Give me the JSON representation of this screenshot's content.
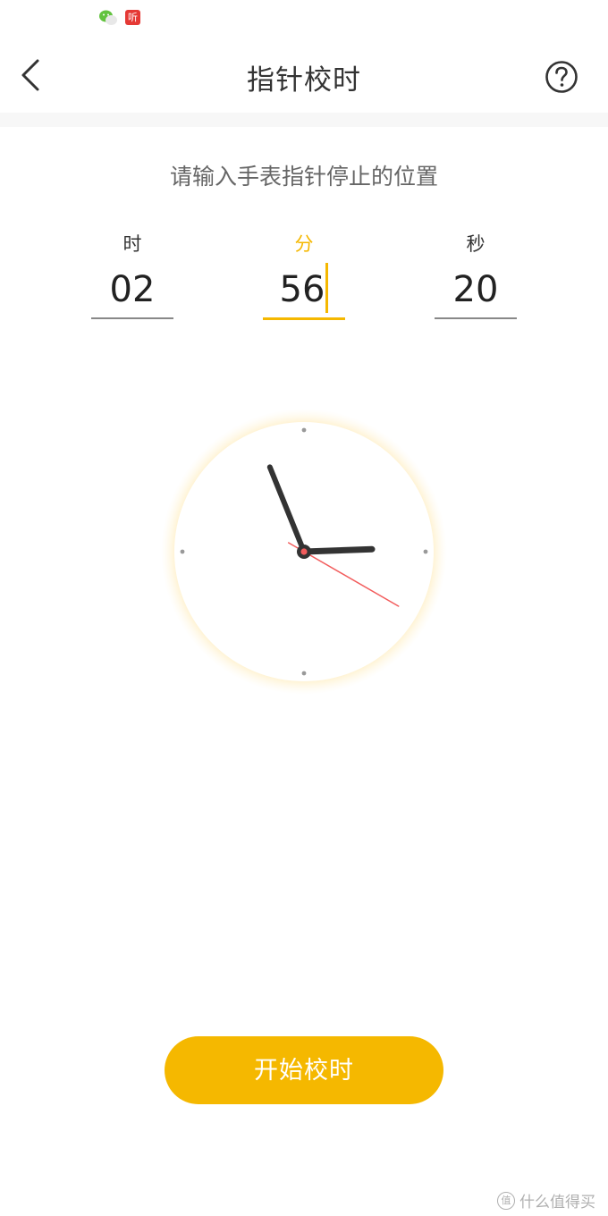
{
  "status_bar": {
    "icons": [
      "wechat-icon",
      "ting-app-icon"
    ],
    "ting_label": "听"
  },
  "header": {
    "title": "指针校时",
    "back_icon": "chevron-left-icon",
    "help_icon": "question-circle-icon"
  },
  "instruction": "请输入手表指针停止的位置",
  "fields": {
    "hour": {
      "label": "时",
      "value": "02"
    },
    "minute": {
      "label": "分",
      "value": "56",
      "active": true
    },
    "second": {
      "label": "秒",
      "value": "20"
    }
  },
  "clock": {
    "hour": 2,
    "minute": 56,
    "second": 20
  },
  "start_button": {
    "label": "开始校时"
  },
  "watermark": {
    "text": "什么值得买",
    "icon_glyph": "值"
  },
  "colors": {
    "accent": "#f5b800",
    "second_hand": "#f25c5c",
    "hands": "#333333"
  }
}
